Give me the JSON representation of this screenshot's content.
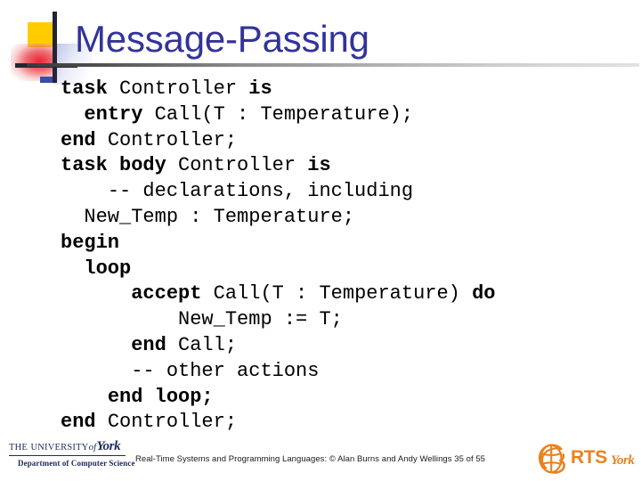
{
  "slide": {
    "title": "Message-Passing",
    "title_color": "#333399",
    "background_color": "#ffffff"
  },
  "decoration": {
    "yellow_square_color": "#ffcc00",
    "red_blur_color": "#e41c28",
    "line_color": "#262433",
    "blue_square_color": "#3b4ea8",
    "rule_color": "#3a3a3a"
  },
  "code": {
    "language": "Ada",
    "lines": [
      {
        "indent": 0,
        "tokens": [
          {
            "t": "task ",
            "k": true
          },
          {
            "t": "Controller ",
            "k": false
          },
          {
            "t": "is",
            "k": true
          }
        ]
      },
      {
        "indent": 1,
        "tokens": [
          {
            "t": "entry ",
            "k": true
          },
          {
            "t": "Call(T : Temperature);",
            "k": false
          }
        ]
      },
      {
        "indent": 0,
        "tokens": [
          {
            "t": "end ",
            "k": true
          },
          {
            "t": "Controller;",
            "k": false
          }
        ]
      },
      {
        "indent": 0,
        "tokens": [
          {
            "t": "task body ",
            "k": true
          },
          {
            "t": "Controller ",
            "k": false
          },
          {
            "t": "is",
            "k": true
          }
        ]
      },
      {
        "indent": 2,
        "tokens": [
          {
            "t": "-- declarations, including",
            "k": false
          }
        ]
      },
      {
        "indent": 1,
        "tokens": [
          {
            "t": "New_Temp : Temperature;",
            "k": false
          }
        ]
      },
      {
        "indent": 0,
        "tokens": [
          {
            "t": "begin",
            "k": true
          }
        ]
      },
      {
        "indent": 1,
        "tokens": [
          {
            "t": "loop",
            "k": true
          }
        ]
      },
      {
        "indent": 3,
        "tokens": [
          {
            "t": "accept ",
            "k": true
          },
          {
            "t": "Call(T : Temperature) ",
            "k": false
          },
          {
            "t": "do",
            "k": true
          }
        ]
      },
      {
        "indent": 5,
        "tokens": [
          {
            "t": "New_Temp := T;",
            "k": false
          }
        ]
      },
      {
        "indent": 3,
        "tokens": [
          {
            "t": "end ",
            "k": true
          },
          {
            "t": "Call;",
            "k": false
          }
        ]
      },
      {
        "indent": 3,
        "tokens": [
          {
            "t": "-- other actions",
            "k": false
          }
        ]
      },
      {
        "indent": 2,
        "tokens": [
          {
            "t": "end loop;",
            "k": true
          }
        ]
      },
      {
        "indent": 0,
        "tokens": [
          {
            "t": "end ",
            "k": true
          },
          {
            "t": "Controller;",
            "k": false
          }
        ]
      }
    ]
  },
  "footer": {
    "note": "Real-Time Systems and Programming Languages: © Alan Burns and Andy Wellings 35 of 55",
    "page_current": "35",
    "page_total": "55"
  },
  "university_logo": {
    "the": "THE",
    "university": "UNIVERSITY",
    "of": "of",
    "york": "York",
    "department": "Department of Computer Science",
    "color": "#1c2a5e"
  },
  "rts_logo": {
    "acronym": "RTS",
    "york": "York",
    "color": "#e8821e"
  }
}
